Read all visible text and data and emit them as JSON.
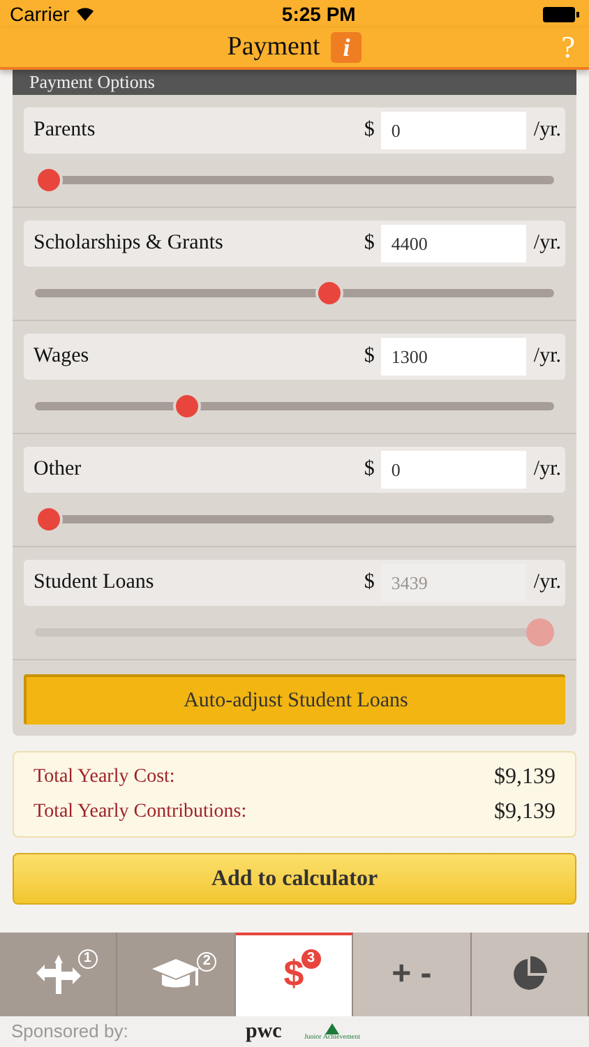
{
  "status_bar": {
    "carrier": "Carrier",
    "time": "5:25 PM"
  },
  "nav": {
    "title": "Payment",
    "info": "i",
    "help": "?"
  },
  "section_title": "Payment Options",
  "rows": [
    {
      "label": "Parents",
      "currency": "$",
      "value": "0",
      "unit": "/yr.",
      "level": 0,
      "disabled": false
    },
    {
      "label": "Scholarships & Grants",
      "currency": "$",
      "value": "4400",
      "unit": "/yr.",
      "level": 0.57,
      "disabled": false
    },
    {
      "label": "Wages",
      "currency": "$",
      "value": "1300",
      "unit": "/yr.",
      "level": 0.28,
      "disabled": false
    },
    {
      "label": "Other",
      "currency": "$",
      "value": "0",
      "unit": "/yr.",
      "level": 0,
      "disabled": false
    },
    {
      "label": "Student Loans",
      "currency": "$",
      "value": "3439",
      "unit": "/yr.",
      "level": 1,
      "disabled": true
    }
  ],
  "auto_button": "Auto-adjust Student Loans",
  "totals": [
    {
      "label": "Total Yearly Cost:",
      "value": "$9,139"
    },
    {
      "label": "Total Yearly Contributions:",
      "value": "$9,139"
    }
  ],
  "add_button": "Add to calculator",
  "tabs": [
    {
      "kind": "signpost",
      "badge": "1",
      "selected": false,
      "done": true
    },
    {
      "kind": "cap",
      "badge": "2",
      "selected": false,
      "done": true
    },
    {
      "kind": "dollar",
      "symbol": "$",
      "badge": "3",
      "selected": true,
      "done": false
    },
    {
      "kind": "text",
      "label": "+ -",
      "selected": false,
      "done": false
    },
    {
      "kind": "pie",
      "selected": false,
      "done": false
    }
  ],
  "sponsor": {
    "label": "Sponsored by:",
    "logos": [
      "pwc",
      "Junior Achievement"
    ]
  }
}
